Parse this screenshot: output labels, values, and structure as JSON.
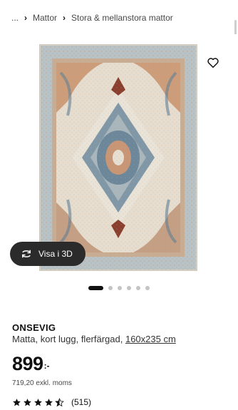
{
  "breadcrumb": {
    "ellipsis": "...",
    "items": [
      "Mattor",
      "Stora & mellanstora mattor"
    ]
  },
  "gallery": {
    "image_alt": "ONSEVIG matta",
    "view3d_label": "Visa i 3D",
    "dot_count": 6,
    "active_dot": 0
  },
  "product": {
    "name": "ONSEVIG",
    "description": "Matta, kort lugg, flerfärgad, ",
    "size": "160x235 cm",
    "price": "899",
    "price_suffix": ":-",
    "price_ex_vat": "719,20 exkl. moms",
    "rating": 4.5,
    "review_count": "(515)"
  },
  "icons": {
    "favorite": "heart-outline-icon",
    "view3d": "rotate-arrows-icon",
    "star": "star-icon"
  },
  "colors": {
    "text": "#111111",
    "view3d_bg": "#2b2b2b",
    "dot_inactive": "#c4c4c4"
  }
}
